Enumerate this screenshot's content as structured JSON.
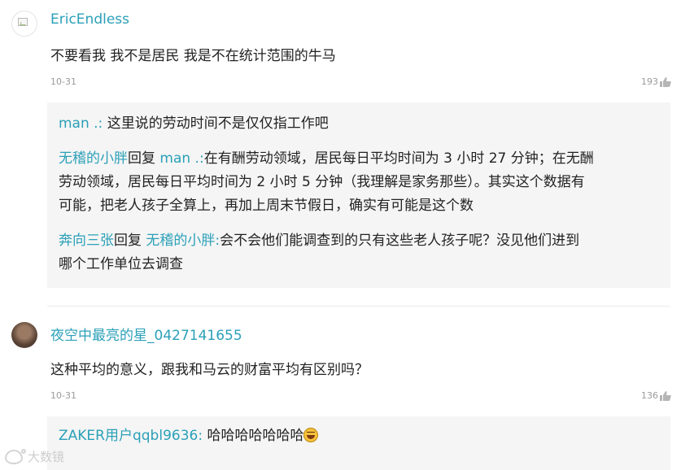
{
  "comments": [
    {
      "username": "EricEndless",
      "text": "不要看我 我不是居民 我是不在统计范围的牛马",
      "date": "10-31",
      "likes": "193",
      "replies": [
        {
          "user": "man .:",
          "text": "这里说的劳动时间不是仅仅指工作吧"
        },
        {
          "user": "无稽的小胖",
          "verb": "回复",
          "target": "man .:",
          "lines": [
            "在有酬劳动领域，居民每日平均时间为 3 小时 27 分钟；在无酬",
            "劳动领域，居民每日平均时间为 2 小时 5 分钟（我理解是家务那些）。其实这个数据有",
            "可能，把老人孩子全算上，再加上周末节假日，确实有可能是这个数"
          ]
        },
        {
          "user": "奔向三张",
          "verb": "回复",
          "target": "无稽的小胖:",
          "lines": [
            "会不会他们能调查到的只有这些老人孩子呢？没见他们进到",
            "哪个工作单位去调查"
          ]
        }
      ]
    },
    {
      "username": "夜空中最亮的星_0427141655",
      "text": "这种平均的意义，跟我和马云的财富平均有区别吗？",
      "date": "10-31",
      "likes": "136",
      "replies": [
        {
          "user": "ZAKER用户qqbl9636:",
          "text": "哈哈哈哈哈哈哈",
          "emoji": "grinning-sweat-emoji"
        }
      ]
    }
  ],
  "watermark": "大数镜",
  "colors": {
    "username": "#2ba0b8",
    "text": "#222222",
    "meta": "#9a9a9a",
    "reply_bg": "#f5f5f5"
  }
}
